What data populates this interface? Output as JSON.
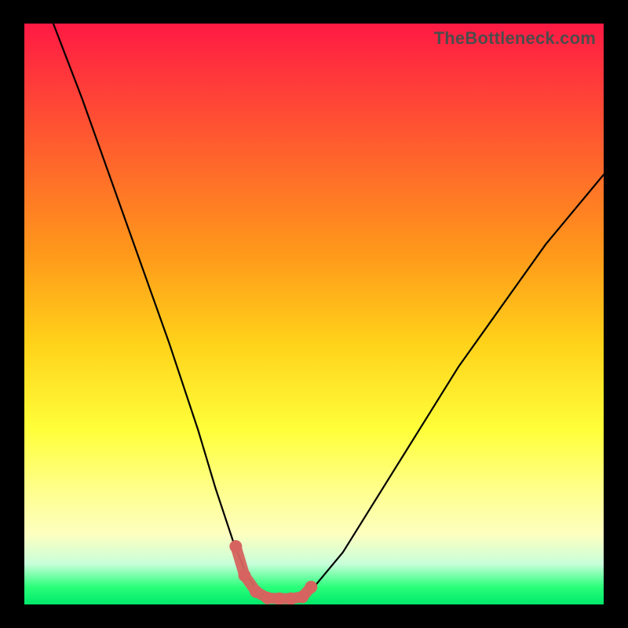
{
  "watermark": "TheBottleneck.com",
  "colors": {
    "page_bg": "#000000",
    "gradient_top": "#ff1a44",
    "gradient_mid": "#ffff3a",
    "gradient_bottom": "#00e86a",
    "curve": "#000000",
    "marker": "#d6635f"
  },
  "chart_data": {
    "type": "line",
    "title": "",
    "xlabel": "",
    "ylabel": "",
    "xlim": [
      0,
      100
    ],
    "ylim": [
      0,
      100
    ],
    "grid": false,
    "legend": false,
    "notes": "Gradient background suggests score: top=bad (red), bottom=good (green). Curve is plotted with y=0 at bottom, y=100 at top. Flat minimum around x≈40–48.",
    "series": [
      {
        "name": "bottleneck-curve",
        "x": [
          5,
          10,
          15,
          20,
          25,
          30,
          33,
          36,
          38,
          40,
          42,
          44,
          46,
          48,
          50,
          55,
          60,
          65,
          70,
          75,
          80,
          85,
          90,
          95,
          100
        ],
        "values": [
          100,
          87,
          73,
          59,
          45,
          30,
          20,
          11,
          6,
          2.5,
          1.2,
          1.0,
          1.0,
          1.2,
          3,
          9,
          17,
          25,
          33,
          41,
          48,
          55,
          62,
          68,
          74
        ]
      }
    ],
    "markers": {
      "name": "highlight-near-min",
      "x": [
        36.5,
        38,
        40,
        42,
        44,
        46,
        48,
        49.5
      ],
      "values": [
        10,
        5,
        2.2,
        1.1,
        1.0,
        1.0,
        1.3,
        3
      ]
    }
  }
}
